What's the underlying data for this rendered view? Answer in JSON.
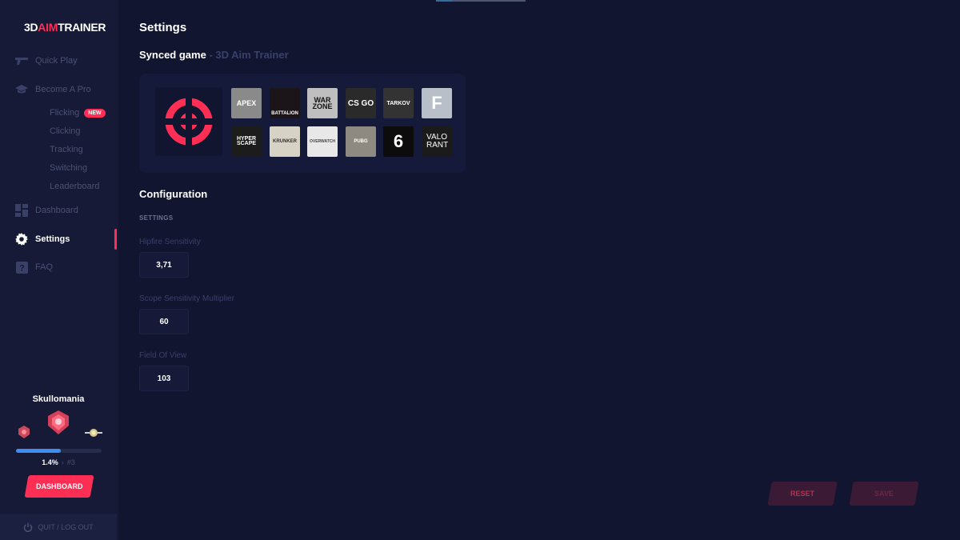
{
  "app": {
    "logo_prefix": "3D",
    "logo_accent": "AIM",
    "logo_suffix": "TRAINER"
  },
  "sidebar": {
    "items": [
      {
        "label": "Quick Play",
        "icon": "gun-icon"
      },
      {
        "label": "Become A Pro",
        "icon": "graduation-cap-icon"
      },
      {
        "label": "Dashboard",
        "icon": "dashboard-icon"
      },
      {
        "label": "Settings",
        "icon": "gear-icon",
        "active": true
      },
      {
        "label": "FAQ",
        "icon": "question-icon"
      }
    ],
    "sub_items": [
      {
        "label": "Flicking",
        "badge": "NEW"
      },
      {
        "label": "Clicking"
      },
      {
        "label": "Tracking"
      },
      {
        "label": "Switching"
      },
      {
        "label": "Leaderboard"
      }
    ]
  },
  "profile": {
    "username": "Skullomania",
    "progress_text": "1.4%",
    "progress_fraction": 0.52,
    "rank": "#3",
    "dashboard_button": "DASHBOARD"
  },
  "quit_label": "QUIT / LOG OUT",
  "main": {
    "title": "Settings",
    "synced_label": "Synced game",
    "synced_game": " - 3D Aim Trainer",
    "games": [
      {
        "label": "APEX"
      },
      {
        "label": "BATTALION"
      },
      {
        "label": "WAR ZONE"
      },
      {
        "label": "CS GO"
      },
      {
        "label": "TARKOV"
      },
      {
        "label": "F"
      },
      {
        "label": "HYPER SCAPE"
      },
      {
        "label": "KRUNKER"
      },
      {
        "label": "OVERWATCH"
      },
      {
        "label": "PUBG"
      },
      {
        "label": "6"
      },
      {
        "label": "VALO RANT"
      }
    ],
    "config_title": "Configuration",
    "settings_section": "SETTINGS",
    "fields": [
      {
        "label": "Hipfire Sensitivity",
        "value": "3,71"
      },
      {
        "label": "Scope Sensitivity Multiplier",
        "value": "60"
      },
      {
        "label": "Field Of View",
        "value": "103"
      }
    ],
    "reset_label": "RESET",
    "save_label": "SAVE"
  },
  "colors": {
    "accent": "#ff2e55",
    "background": "#121530",
    "sidebar": "#161a36",
    "progress": "#3d8ef0"
  }
}
